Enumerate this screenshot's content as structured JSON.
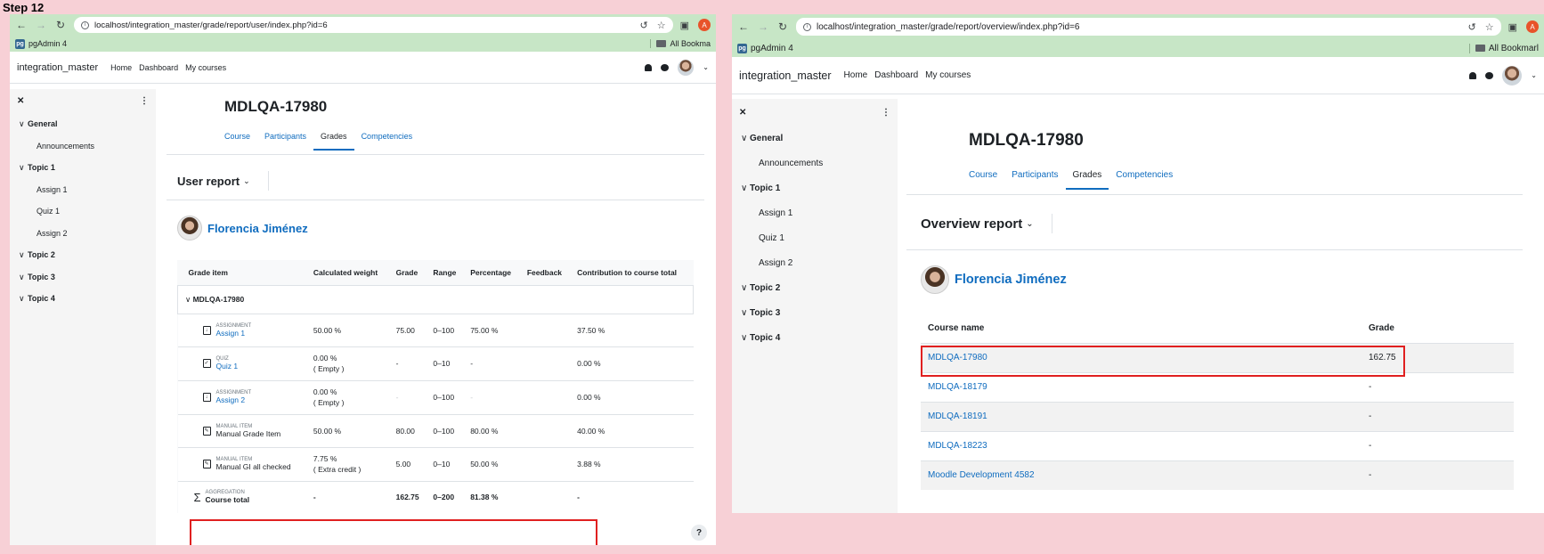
{
  "step_label": "Step 12",
  "left": {
    "url": "localhost/integration_master/grade/report/user/index.php?id=6",
    "bookmark": "pgAdmin 4",
    "bookmark_folder": "All Bookma",
    "ext_letter": "A",
    "site_name": "integration_master",
    "nav": [
      "Home",
      "Dashboard",
      "My courses"
    ],
    "drawer": [
      {
        "label": "General",
        "type": "section"
      },
      {
        "label": "Announcements",
        "type": "item"
      },
      {
        "label": "Topic 1",
        "type": "section"
      },
      {
        "label": "Assign 1",
        "type": "item"
      },
      {
        "label": "Quiz 1",
        "type": "item"
      },
      {
        "label": "Assign 2",
        "type": "item"
      },
      {
        "label": "Topic 2",
        "type": "section"
      },
      {
        "label": "Topic 3",
        "type": "section"
      },
      {
        "label": "Topic 4",
        "type": "section"
      }
    ],
    "course_title": "MDLQA-17980",
    "tabs": [
      "Course",
      "Participants",
      "Grades",
      "Competencies"
    ],
    "active_tab": "Grades",
    "report": "User report",
    "user": "Florencia Jiménez",
    "columns": [
      "Grade item",
      "Calculated weight",
      "Grade",
      "Range",
      "Percentage",
      "Feedback",
      "Contribution to course total"
    ],
    "category": "MDLQA-17980",
    "rows": [
      {
        "type": "ASSIGNMENT",
        "name": "Assign 1",
        "weight": "50.00 %",
        "weight2": "",
        "grade": "75.00",
        "range": "0–100",
        "pct": "75.00 %",
        "feedback": "",
        "contrib": "37.50 %",
        "icon": "assignment-icon",
        "link": true
      },
      {
        "type": "QUIZ",
        "name": "Quiz 1",
        "weight": "0.00 %",
        "weight2": "( Empty )",
        "grade": "-",
        "range": "0–10",
        "pct": "-",
        "feedback": "",
        "contrib": "0.00 %",
        "icon": "quiz-icon",
        "link": true
      },
      {
        "type": "ASSIGNMENT",
        "name": "Assign 2",
        "weight": "0.00 %",
        "weight2": "( Empty )",
        "grade": "-",
        "range": "0–100",
        "pct": "-",
        "feedback": "",
        "contrib": "0.00 %",
        "icon": "assignment-icon",
        "link": true
      },
      {
        "type": "MANUAL ITEM",
        "name": "Manual Grade Item",
        "weight": "50.00 %",
        "weight2": "",
        "grade": "80.00",
        "range": "0–100",
        "pct": "80.00 %",
        "feedback": "",
        "contrib": "40.00 %",
        "icon": "edit-icon",
        "link": false
      },
      {
        "type": "MANUAL ITEM",
        "name": "Manual GI all checked",
        "weight": "7.75 %",
        "weight2": "( Extra credit )",
        "grade": "5.00",
        "range": "0–10",
        "pct": "50.00 %",
        "feedback": "",
        "contrib": "3.88 %",
        "icon": "edit-icon",
        "link": false
      }
    ],
    "total": {
      "type": "AGGREGATION",
      "name": "Course total",
      "weight": "-",
      "grade": "162.75",
      "range": "0–200",
      "pct": "81.38 %",
      "contrib": "-"
    },
    "help": "?"
  },
  "right": {
    "url": "localhost/integration_master/grade/report/overview/index.php?id=6",
    "bookmark": "pgAdmin 4",
    "bookmark_folder": "All Bookmarl",
    "ext_letter": "A",
    "site_name": "integration_master",
    "nav": [
      "Home",
      "Dashboard",
      "My courses"
    ],
    "drawer": [
      {
        "label": "General",
        "type": "section"
      },
      {
        "label": "Announcements",
        "type": "item"
      },
      {
        "label": "Topic 1",
        "type": "section"
      },
      {
        "label": "Assign 1",
        "type": "item"
      },
      {
        "label": "Quiz 1",
        "type": "item"
      },
      {
        "label": "Assign 2",
        "type": "item"
      },
      {
        "label": "Topic 2",
        "type": "section"
      },
      {
        "label": "Topic 3",
        "type": "section"
      },
      {
        "label": "Topic 4",
        "type": "section"
      }
    ],
    "course_title": "MDLQA-17980",
    "tabs": [
      "Course",
      "Participants",
      "Grades",
      "Competencies"
    ],
    "active_tab": "Grades",
    "report": "Overview report",
    "user": "Florencia Jiménez",
    "columns": [
      "Course name",
      "Grade"
    ],
    "courses": [
      {
        "name": "MDLQA-17980",
        "grade": "162.75"
      },
      {
        "name": "MDLQA-18179",
        "grade": "-"
      },
      {
        "name": "MDLQA-18191",
        "grade": "-"
      },
      {
        "name": "MDLQA-18223",
        "grade": "-"
      },
      {
        "name": "Moodle Development 4582",
        "grade": "-"
      }
    ]
  },
  "colors": {
    "accent": "#0f6cbf",
    "highlight": "#e02020",
    "chrome": "#c7e6c6",
    "background": "#f7d0d6"
  }
}
